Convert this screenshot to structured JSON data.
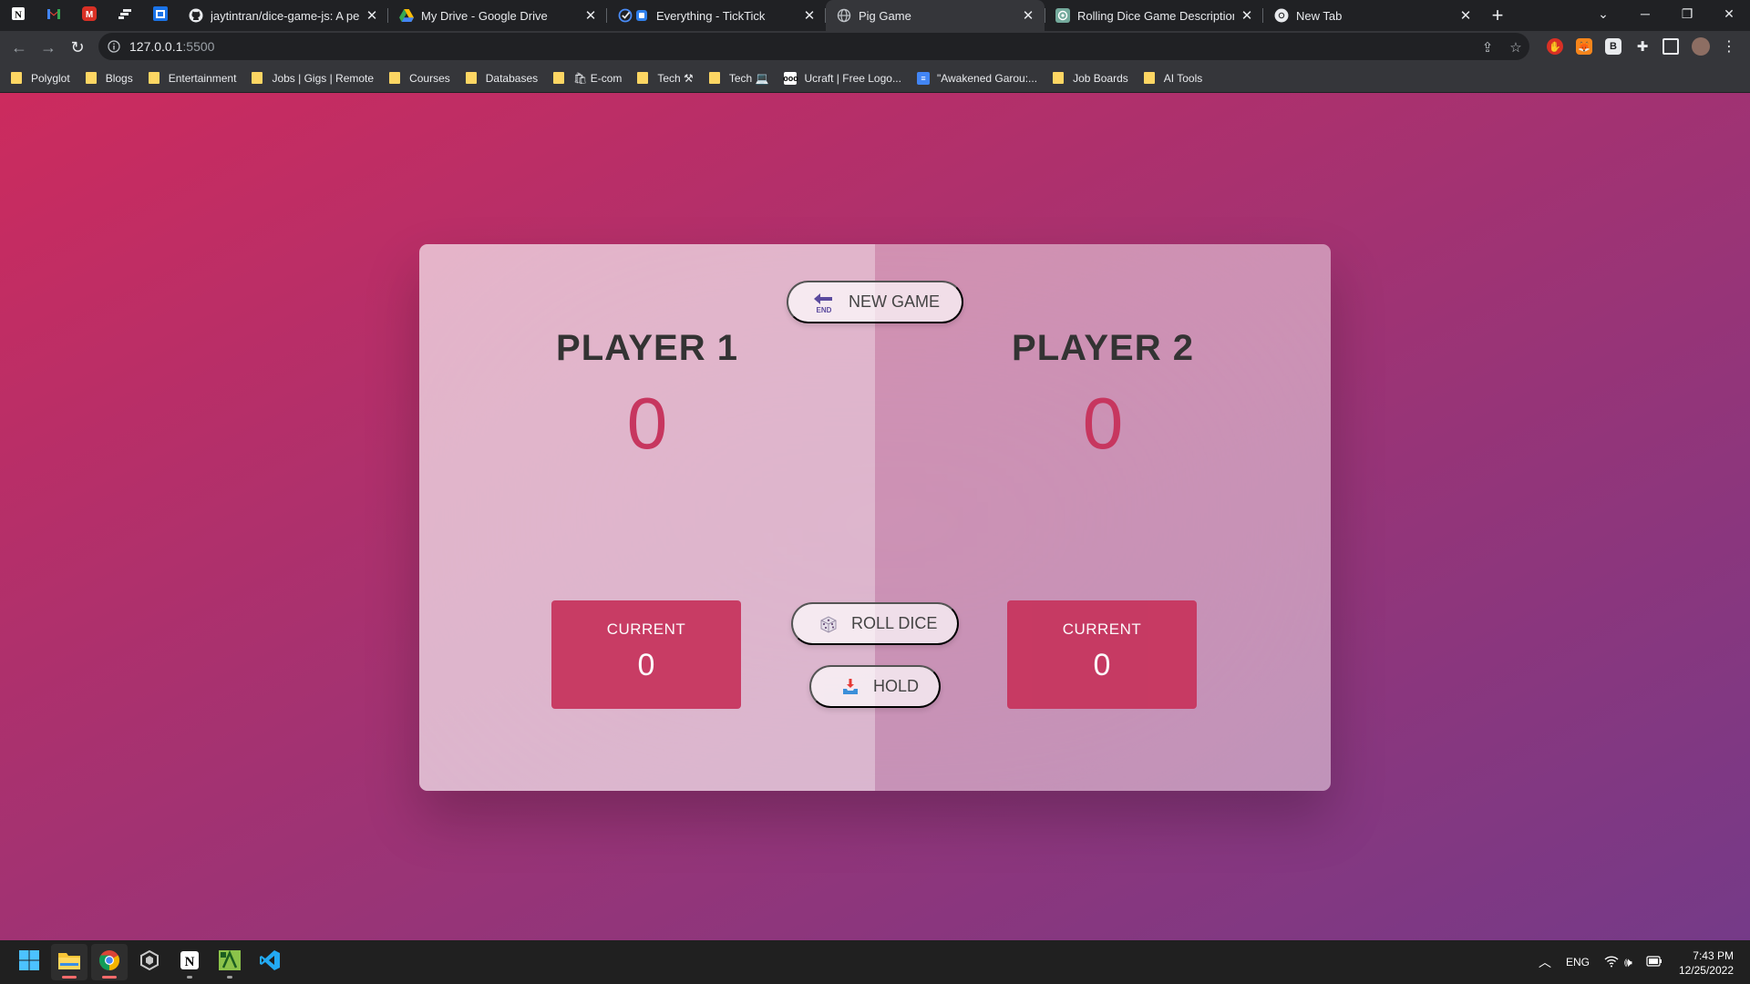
{
  "browser": {
    "pinned_tabs": [
      {
        "name": "notion",
        "icon": "notion-icon"
      },
      {
        "name": "gmail",
        "icon": "gmail-icon"
      },
      {
        "name": "mail",
        "icon": "red-mail-icon"
      },
      {
        "name": "app",
        "icon": "app-icon"
      },
      {
        "name": "calendar",
        "icon": "calendar-icon"
      }
    ],
    "tabs": [
      {
        "title": "jaytintran/dice-game-js: A perso",
        "icon": "github-icon",
        "active": false
      },
      {
        "title": "My Drive - Google Drive",
        "icon": "google-drive-icon",
        "active": false
      },
      {
        "title": "Everything - TickTick",
        "icon": "ticktick-icon",
        "active": false
      },
      {
        "title": "Pig Game",
        "icon": "globe-icon",
        "active": true
      },
      {
        "title": "Rolling Dice Game Description",
        "icon": "chatgpt-icon",
        "active": false
      },
      {
        "title": "New Tab",
        "icon": "chrome-icon",
        "active": false
      }
    ],
    "new_tab_symbol": "+",
    "address": {
      "host": "127.0.0.1",
      "port": ":5500"
    },
    "bookmarks": [
      {
        "label": "Polyglot",
        "type": "folder"
      },
      {
        "label": "Blogs",
        "type": "folder"
      },
      {
        "label": "Entertainment",
        "type": "folder"
      },
      {
        "label": "Jobs | Gigs | Remote",
        "type": "folder"
      },
      {
        "label": "Courses",
        "type": "folder"
      },
      {
        "label": "Databases",
        "type": "folder"
      },
      {
        "label": "🛍 E-com",
        "type": "folder"
      },
      {
        "label": "Tech ⚒",
        "type": "folder"
      },
      {
        "label": "Tech 💻",
        "type": "folder"
      },
      {
        "label": "Ucraft | Free Logo...",
        "type": "favicon"
      },
      {
        "label": "\"Awakened Garou:...",
        "type": "favicon"
      },
      {
        "label": "Job Boards",
        "type": "folder"
      },
      {
        "label": "AI Tools",
        "type": "folder"
      }
    ]
  },
  "game": {
    "new_game_label": "New game",
    "roll_dice_label": "Roll dice",
    "hold_label": "Hold",
    "players": [
      {
        "name": "Player 1",
        "score": "0",
        "current_label": "Current",
        "current_score": "0",
        "active": true
      },
      {
        "name": "Player 2",
        "score": "0",
        "current_label": "Current",
        "current_score": "0",
        "active": false
      }
    ],
    "colors": {
      "accent": "#c7365f",
      "gradient_start": "#cc2b5e",
      "gradient_end": "#753a88"
    }
  },
  "taskbar": {
    "apps": [
      "windows-start-icon",
      "file-explorer-icon",
      "chrome-icon",
      "app-icon",
      "notion-icon",
      "android-studio-icon",
      "vscode-icon"
    ],
    "language": "ENG",
    "time": "7:43 PM",
    "date": "12/25/2022"
  }
}
